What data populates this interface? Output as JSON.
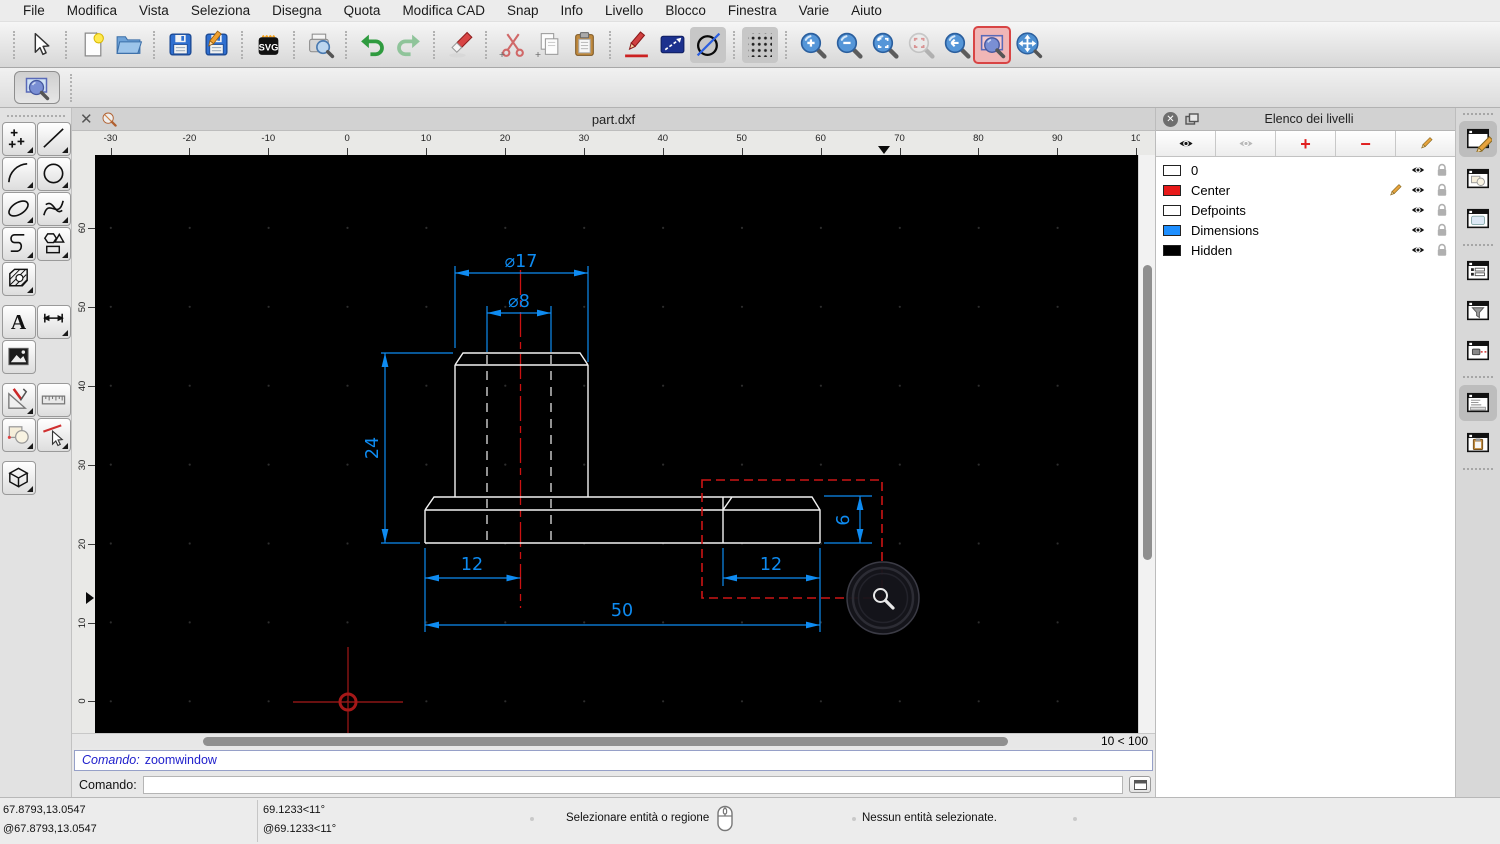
{
  "menu": {
    "items": [
      "File",
      "Modifica",
      "Vista",
      "Seleziona",
      "Disegna",
      "Quota",
      "Modifica CAD",
      "Snap",
      "Info",
      "Livello",
      "Blocco",
      "Finestra",
      "Varie",
      "Aiuto"
    ]
  },
  "toolbar": {
    "icons": [
      "select-arrow",
      "new-document",
      "open-folder",
      "save",
      "save-as",
      "svg-export",
      "print-preview",
      "undo",
      "redo",
      "eraser",
      "cut",
      "copy",
      "paste",
      "attributes-pencil",
      "selection-order",
      "construction-circle",
      "grid-toggle",
      "zoom-in",
      "zoom-out",
      "zoom-auto",
      "zoom-selection",
      "zoom-previous",
      "zoom-window",
      "zoom-pan"
    ],
    "active_tool": "zoom-window"
  },
  "tabbar": {
    "title": "part.dxf"
  },
  "rulers": {
    "h_labels": [
      "-30",
      "-20",
      "-10",
      "0",
      "10",
      "20",
      "30",
      "40",
      "50",
      "60",
      "70",
      "80",
      "90",
      "10"
    ],
    "v_labels": [
      "60",
      "50",
      "40",
      "30",
      "20",
      "10",
      "0"
    ]
  },
  "drawing": {
    "dimensions": {
      "diameter_outer": "⌀17",
      "diameter_inner": "⌀8",
      "height": "24",
      "offset_left": "12",
      "width_total": "50",
      "offset_right": "12",
      "plate_height": "6"
    },
    "colors": {
      "dimension": "#0e8bf1",
      "outline": "#f2f2f2",
      "centerline": "#cc1111",
      "selection_box": "#cc1515"
    }
  },
  "view": {
    "zoom_info": "10 < 100"
  },
  "layer_panel": {
    "title": "Elenco dei livelli",
    "layers": [
      {
        "name": "0",
        "color": "#ffffff",
        "current": false
      },
      {
        "name": "Center",
        "color": "#e81a1a",
        "current": true
      },
      {
        "name": "Defpoints",
        "color": "#ffffff",
        "current": false
      },
      {
        "name": "Dimensions",
        "color": "#1e8fff",
        "current": false
      },
      {
        "name": "Hidden",
        "color": "#000000",
        "current": false
      }
    ]
  },
  "command": {
    "history_label": "Comando:",
    "history_command": "zoomwindow",
    "prompt_label": "Comando:"
  },
  "status": {
    "coords_abs": "67.8793,13.0547",
    "coords_rel": "@67.8793,13.0547",
    "polar_abs": "69.1233<11°",
    "polar_rel": "@69.1233<11°",
    "hint": "Selezionare entità o regione",
    "selection": "Nessun entità selezionate."
  }
}
